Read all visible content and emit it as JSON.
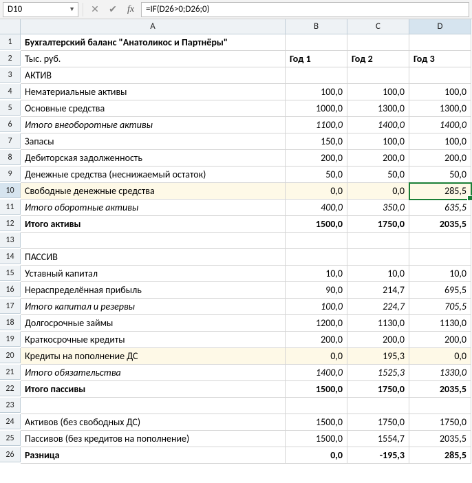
{
  "nameBox": "D10",
  "formula": "=IF(D26>0;D26;0)",
  "columns": [
    "A",
    "B",
    "C",
    "D"
  ],
  "selectedCol": "D",
  "selectedRow": 10,
  "chart_data": {
    "type": "table",
    "title": "Бухгалтерский баланс \"Анатоликос и Партнёры\"",
    "unit": "Тыс. руб.",
    "columns": [
      "Год 1",
      "Год 2",
      "Год 3"
    ],
    "rows": [
      {
        "label": "АКТИВ"
      },
      {
        "label": "Нематериальные активы",
        "values": [
          "100,0",
          "100,0",
          "100,0"
        ]
      },
      {
        "label": "Основные средства",
        "values": [
          "1000,0",
          "1300,0",
          "1300,0"
        ]
      },
      {
        "label": "Итого внеоборотные активы",
        "values": [
          "1100,0",
          "1400,0",
          "1400,0"
        ],
        "italic": true
      },
      {
        "label": "Запасы",
        "values": [
          "150,0",
          "100,0",
          "100,0"
        ]
      },
      {
        "label": "Дебиторская задолженность",
        "values": [
          "200,0",
          "200,0",
          "200,0"
        ]
      },
      {
        "label": "Денежные средства (неснижаемый остаток)",
        "values": [
          "50,0",
          "50,0",
          "50,0"
        ]
      },
      {
        "label": "Свободные денежные средства",
        "values": [
          "0,0",
          "0,0",
          "285,5"
        ],
        "hl": true
      },
      {
        "label": "Итого оборотные активы",
        "values": [
          "400,0",
          "350,0",
          "635,5"
        ],
        "italic": true
      },
      {
        "label": "Итого активы",
        "values": [
          "1500,0",
          "1750,0",
          "2035,5"
        ],
        "bold": true
      },
      {
        "label": ""
      },
      {
        "label": "ПАССИВ"
      },
      {
        "label": "Уставный капитал",
        "values": [
          "10,0",
          "10,0",
          "10,0"
        ]
      },
      {
        "label": "Нераспределённая прибыль",
        "values": [
          "90,0",
          "214,7",
          "695,5"
        ]
      },
      {
        "label": "Итого капитал и резервы",
        "values": [
          "100,0",
          "224,7",
          "705,5"
        ],
        "italic": true
      },
      {
        "label": "Долгосрочные займы",
        "values": [
          "1200,0",
          "1130,0",
          "1130,0"
        ]
      },
      {
        "label": "Краткосрочные кредиты",
        "values": [
          "200,0",
          "200,0",
          "200,0"
        ]
      },
      {
        "label": "Кредиты на пополнение ДС",
        "values": [
          "0,0",
          "195,3",
          "0,0"
        ],
        "hl": true
      },
      {
        "label": "Итого обязательства",
        "values": [
          "1400,0",
          "1525,3",
          "1330,0"
        ],
        "italic": true
      },
      {
        "label": "Итого пассивы",
        "values": [
          "1500,0",
          "1750,0",
          "2035,5"
        ],
        "bold": true
      },
      {
        "label": ""
      },
      {
        "label": "Активов (без свободных ДС)",
        "values": [
          "1500,0",
          "1750,0",
          "1750,0"
        ]
      },
      {
        "label": "Пассивов (без кредитов на пополнение)",
        "values": [
          "1500,0",
          "1554,7",
          "2035,5"
        ]
      },
      {
        "label": "Разница",
        "values": [
          "0,0",
          "-195,3",
          "285,5"
        ],
        "bold": true
      }
    ]
  }
}
